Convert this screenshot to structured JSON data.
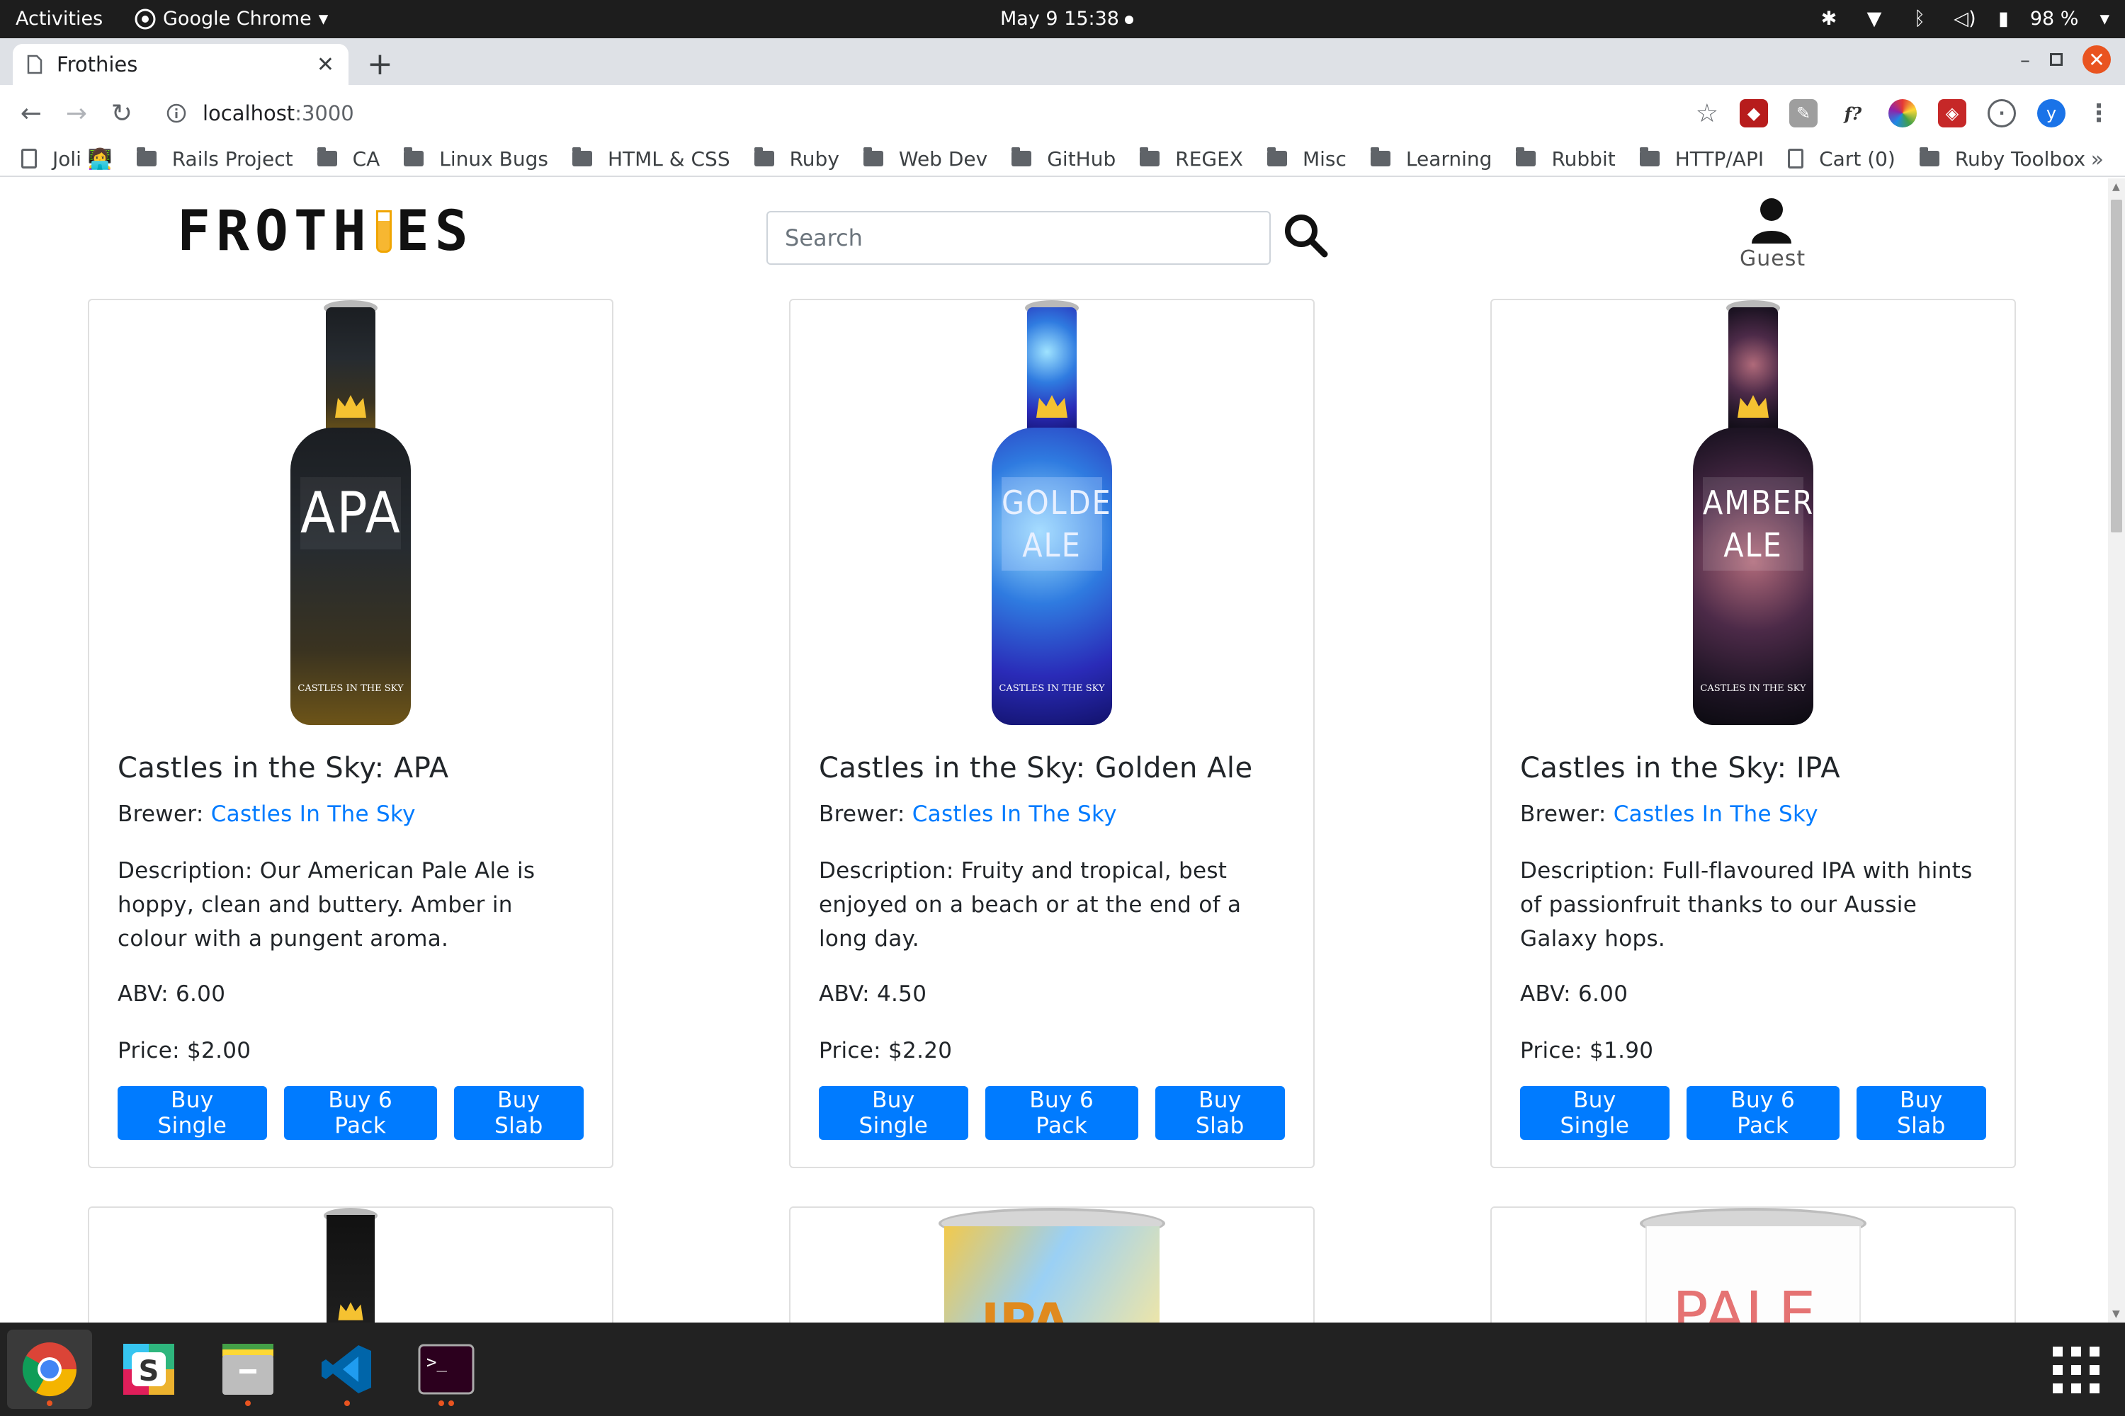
{
  "system": {
    "activities": "Activities",
    "app_name": "Google Chrome",
    "clock": "May 9  15:38",
    "battery": "98 %"
  },
  "browser": {
    "tab_title": "Frothies",
    "url_host": "localhost",
    "url_port": ":3000",
    "bookmarks": [
      {
        "label": "Joli 👩‍💻",
        "icon": "page-icon"
      },
      {
        "label": "Rails Project",
        "icon": "folder-icon"
      },
      {
        "label": "CA",
        "icon": "folder-icon"
      },
      {
        "label": "Linux Bugs",
        "icon": "folder-icon"
      },
      {
        "label": "HTML & CSS",
        "icon": "folder-icon"
      },
      {
        "label": "Ruby",
        "icon": "folder-icon"
      },
      {
        "label": "Web Dev",
        "icon": "folder-icon"
      },
      {
        "label": "GitHub",
        "icon": "folder-icon"
      },
      {
        "label": "REGEX",
        "icon": "folder-icon"
      },
      {
        "label": "Misc",
        "icon": "folder-icon"
      },
      {
        "label": "Learning",
        "icon": "folder-icon"
      },
      {
        "label": "Rubbit",
        "icon": "folder-icon"
      },
      {
        "label": "HTTP/API",
        "icon": "folder-icon"
      },
      {
        "label": "Cart (0)",
        "icon": "page-icon"
      },
      {
        "label": "Ruby Toolbox",
        "icon": "folder-icon"
      }
    ],
    "bookmarks_more": "»",
    "profile_initial": "y"
  },
  "site": {
    "logo_left": "FROTH",
    "logo_right": "ES",
    "search_placeholder": "Search",
    "user_label": "Guest",
    "brand_color": "#007bff"
  },
  "products": [
    {
      "title": "Castles in the Sky: APA",
      "brewer_label": "Brewer: ",
      "brewer": "Castles In The Sky",
      "description": "Description: Our American Pale Ale is hoppy, clean and buttery. Amber in colour with a pungent aroma.",
      "abv": "ABV: 6.00",
      "price": "Price: $2.00",
      "label_lines": [
        "APA"
      ],
      "bottle_brand": "CASTLES IN THE SKY",
      "buy_single": "Buy Single",
      "buy_six": "Buy 6 Pack",
      "buy_slab": "Buy Slab"
    },
    {
      "title": "Castles in the Sky: Golden Ale",
      "brewer_label": "Brewer: ",
      "brewer": "Castles In The Sky",
      "description": "Description: Fruity and tropical, best enjoyed on a beach or at the end of a long day.",
      "abv": "ABV: 4.50",
      "price": "Price: $2.20",
      "label_lines": [
        "GOLDEN",
        "ALE"
      ],
      "bottle_brand": "CASTLES IN THE SKY",
      "buy_single": "Buy Single",
      "buy_six": "Buy 6 Pack",
      "buy_slab": "Buy Slab"
    },
    {
      "title": "Castles in the Sky: IPA",
      "brewer_label": "Brewer: ",
      "brewer": "Castles In The Sky",
      "description": "Description: Full-flavoured IPA with hints of passionfruit thanks to our Aussie Galaxy hops.",
      "abv": "ABV: 6.00",
      "price": "Price: $1.90",
      "label_lines": [
        "AMBER",
        "ALE"
      ],
      "bottle_brand": "CASTLES IN THE SKY",
      "buy_single": "Buy Single",
      "buy_six": "Buy 6 Pack",
      "buy_slab": "Buy Slab"
    }
  ],
  "second_row_labels": [
    "IPA",
    "PALE"
  ],
  "taskbar": [
    "chrome-icon",
    "slack-icon",
    "files-icon",
    "vscode-icon",
    "terminal-icon",
    "apps-grid-icon"
  ]
}
